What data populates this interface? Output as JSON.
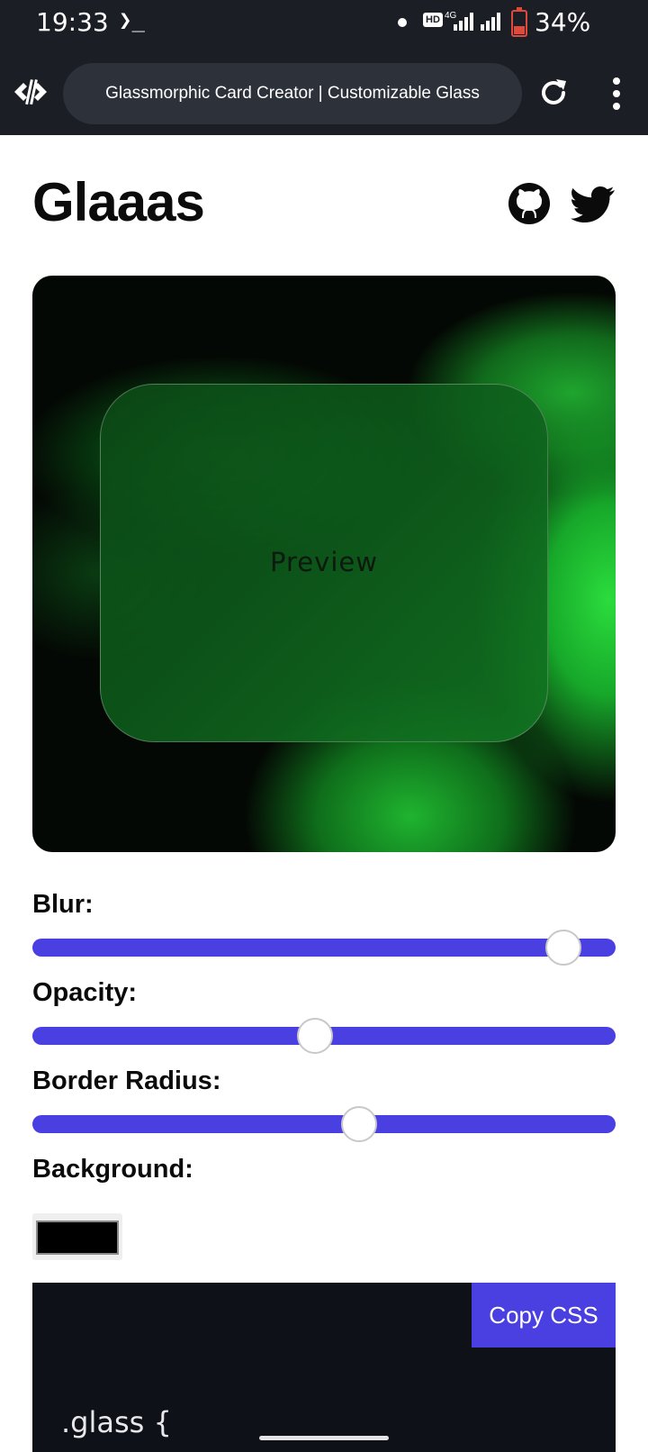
{
  "status_bar": {
    "time": "19:33",
    "terminal_glyph": "❯_",
    "hd_badge": "HD",
    "network": "4G",
    "battery_percent": "34%",
    "battery_level": 0.34,
    "battery_color": "#e04a3b"
  },
  "browser": {
    "site_icon": "code-brackets-icon",
    "url_title": "Glassmorphic Card Creator | Customizable Glass",
    "reload_icon": "reload-icon",
    "menu_icon": "kebab-menu-icon"
  },
  "header": {
    "title": "Glaaas",
    "github_icon": "github-icon",
    "twitter_icon": "twitter-icon"
  },
  "preview": {
    "label": "Preview"
  },
  "controls": {
    "blur": {
      "label": "Blur:",
      "value_fraction": 0.91
    },
    "opacity": {
      "label": "Opacity:",
      "value_fraction": 0.485
    },
    "border_radius": {
      "label": "Border Radius:",
      "value_fraction": 0.56
    },
    "background": {
      "label": "Background:",
      "color": "#000000"
    }
  },
  "css_output": {
    "copy_button": "Copy CSS",
    "code_first_line": ".glass {"
  },
  "colors": {
    "accent": "#4a3fe0",
    "chrome_bg": "#1b1e24",
    "code_bg": "#0f1118"
  }
}
